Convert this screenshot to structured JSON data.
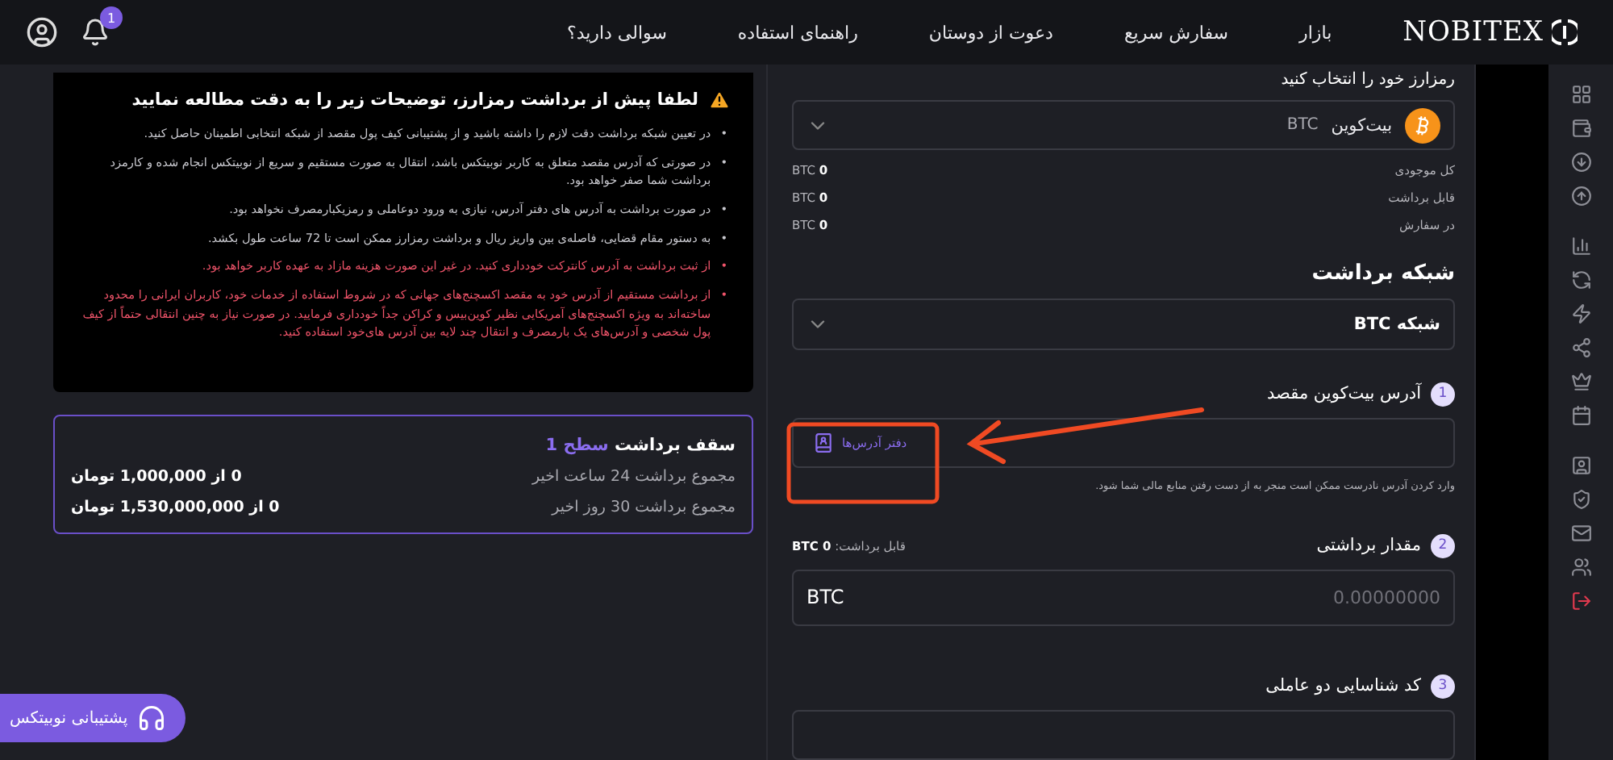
{
  "header": {
    "logo": "NOBITEX",
    "links": [
      "بازار",
      "سفارش سریع",
      "دعوت از دوستان",
      "راهنمای استفاده",
      "سوالی دارید؟"
    ],
    "notification_count": "1"
  },
  "warning": {
    "bullet": "•",
    "title": "لطفا پیش از برداشت رمزارز، توضیحات زیر را به دقت مطالعه نمایید",
    "items": [
      {
        "kind": "normal",
        "text": "در تعیین شبکه برداشت دقت لازم را داشته باشید و از پشتیبانی کیف پول مقصد از شبکه انتخابی اطمینان حاصل کنید."
      },
      {
        "kind": "normal",
        "text": "در صورتی که آدرس مقصد متعلق به کاربر نوبیتکس باشد، انتقال به صورت مستقیم و سریع از نوبیتکس انجام شده و کارمزد برداشت شما صفر خواهد بود."
      },
      {
        "kind": "normal",
        "text": "در صورت برداشت به آدرس های دفتر آدرس، نیازی به ورود دوعاملی و رمزیکبارمصرف نخواهد بود."
      },
      {
        "kind": "normal",
        "text": "به دستور مقام قضایی، فاصله‌ی بین واریز ریال و برداشت رمزارز ممکن است تا 72 ساعت طول بکشد."
      },
      {
        "kind": "alert",
        "text": "از ثبت برداشت به آدرس کانترکت خودداری کنید. در غیر این صورت هزینه مازاد به عهده کاربر خواهد بود."
      },
      {
        "kind": "alert",
        "text": "از برداشت مستقیم از آدرس خود به مقصد اکسچنج‌های جهانی که در شروط استفاده از خدمات خود، کاربران ایرانی را محدود ساخته‌اند به ویژه اکسچنج‌های آمریکایی نظیر کوین‌بیس و کراکن جداً خودداری فرمایید. در صورت نیاز به چنین انتقالی حتماً از کیف پول شخصی و آدرس‌های یک بارمصرف و انتقال چند لایه بین آدرس های‌خود استفاده کنید."
      }
    ]
  },
  "limits": {
    "title": "سقف برداشت",
    "level": "سطح 1",
    "rows": [
      {
        "label": "مجموع برداشت 24 ساعت اخیر",
        "value": "0 از 1,000,000 تومان"
      },
      {
        "label": "مجموع برداشت 30 روز اخیر",
        "value": "0 از 1,530,000,000 تومان"
      }
    ]
  },
  "form": {
    "coin_label": "رمزارز خود را انتخاب کنید",
    "coin": {
      "name": "بیت‌کوین",
      "symbol": "BTC"
    },
    "balances": [
      {
        "label": "کل موجودی",
        "amount": "0",
        "unit": "BTC"
      },
      {
        "label": "قابل برداشت",
        "amount": "0",
        "unit": "BTC"
      },
      {
        "label": "در سفارش",
        "amount": "0",
        "unit": "BTC"
      }
    ],
    "network_title": "شبکه برداشت",
    "network": "شبکه BTC",
    "address": {
      "number": "1",
      "label": "آدرس بیت‌کوین مقصد",
      "book_button": "دفتر آدرس‌ها",
      "hint": "وارد کردن آدرس نادرست ممکن است منجر به از دست رفتن منابع مالی شما شود."
    },
    "amount": {
      "number": "2",
      "label": "مقدار برداشتی",
      "available_label": "قابل برداشت:",
      "available": "0",
      "unit": "BTC",
      "placeholder": "0.00000000",
      "currency": "BTC"
    },
    "twofa": {
      "number": "3",
      "label": "کد شناسایی دو عاملی"
    }
  },
  "support": {
    "label": "پشتیبانی نوبیتکس"
  }
}
